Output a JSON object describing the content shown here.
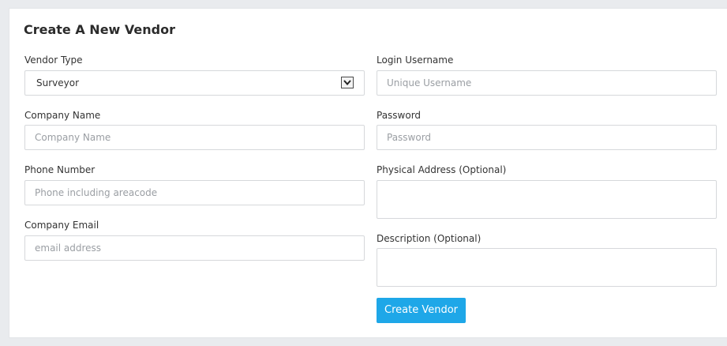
{
  "form": {
    "title": "Create A New Vendor",
    "vendor_type": {
      "label": "Vendor Type",
      "selected": "Surveyor"
    },
    "company_name": {
      "label": "Company Name",
      "placeholder": "Company Name"
    },
    "phone_number": {
      "label": "Phone Number",
      "placeholder": "Phone including areacode"
    },
    "company_email": {
      "label": "Company Email",
      "placeholder": "email address"
    },
    "login_username": {
      "label": "Login Username",
      "placeholder": "Unique Username"
    },
    "password": {
      "label": "Password",
      "placeholder": "Password"
    },
    "physical_address": {
      "label": "Physical Address (Optional)"
    },
    "description": {
      "label": "Description (Optional)"
    },
    "submit_label": "Create Vendor"
  },
  "colors": {
    "background": "#e9ebee",
    "panel": "#ffffff",
    "field_border": "#d6d8db",
    "placeholder": "#9a9ea3",
    "button": "#1ea7e8",
    "button_text": "#ffffff"
  },
  "icons": {
    "select_arrow": "chevron-down-icon"
  }
}
